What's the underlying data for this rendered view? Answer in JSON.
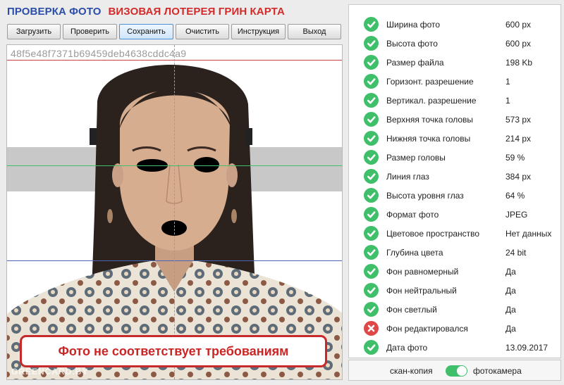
{
  "header": {
    "title_part1": "ПРОВЕРКА ФОТО",
    "title_part2": "ВИЗОВАЯ ЛОТЕРЕЯ ГРИН КАРТА"
  },
  "toolbar": {
    "buttons": [
      {
        "label": "Загрузить"
      },
      {
        "label": "Проверить"
      },
      {
        "label": "Сохранить",
        "active": true
      },
      {
        "label": "Очистить"
      },
      {
        "label": "Инструкция"
      },
      {
        "label": "Выход"
      }
    ]
  },
  "photo": {
    "id": "48f5e48f7371b69459deb4638cddc4a9",
    "warning": "Фото не соответствует требованиям",
    "watermark": "GREENCARD.BY"
  },
  "checks": [
    {
      "label": "Ширина фото",
      "value": "600 px",
      "status": "ok"
    },
    {
      "label": "Высота фото",
      "value": "600 px",
      "status": "ok"
    },
    {
      "label": "Размер файла",
      "value": "198 Kb",
      "status": "ok"
    },
    {
      "label": "Горизонт. разрешение",
      "value": "1",
      "status": "ok"
    },
    {
      "label": "Вертикал. разрешение",
      "value": "1",
      "status": "ok"
    },
    {
      "label": "Верхняя точка головы",
      "value": "573 px",
      "status": "ok"
    },
    {
      "label": "Нижняя точка головы",
      "value": "214 px",
      "status": "ok"
    },
    {
      "label": "Размер головы",
      "value": "59 %",
      "status": "ok"
    },
    {
      "label": "Линия глаз",
      "value": "384 px",
      "status": "ok"
    },
    {
      "label": "Высота уровня глаз",
      "value": "64 %",
      "status": "ok"
    },
    {
      "label": "Формат фото",
      "value": "JPEG",
      "status": "ok"
    },
    {
      "label": "Цветовое пространство",
      "value": "Нет данных",
      "status": "ok"
    },
    {
      "label": "Глубина цвета",
      "value": "24 bit",
      "status": "ok"
    },
    {
      "label": "Фон равномерный",
      "value": "Да",
      "status": "ok"
    },
    {
      "label": "Фон нейтральный",
      "value": "Да",
      "status": "ok"
    },
    {
      "label": "Фон светлый",
      "value": "Да",
      "status": "ok"
    },
    {
      "label": "Фон редактировался",
      "value": "Да",
      "status": "error"
    },
    {
      "label": "Дата фото",
      "value": "13.09.2017",
      "status": "ok"
    }
  ],
  "toggle": {
    "left_label": "скан-копия",
    "right_label": "фотокамера",
    "on": true
  },
  "colors": {
    "ok": "#3fbf6a",
    "error": "#e04848",
    "title_blue": "#2b4ea8",
    "title_red": "#d42a2a",
    "warning": "#cc2525"
  }
}
